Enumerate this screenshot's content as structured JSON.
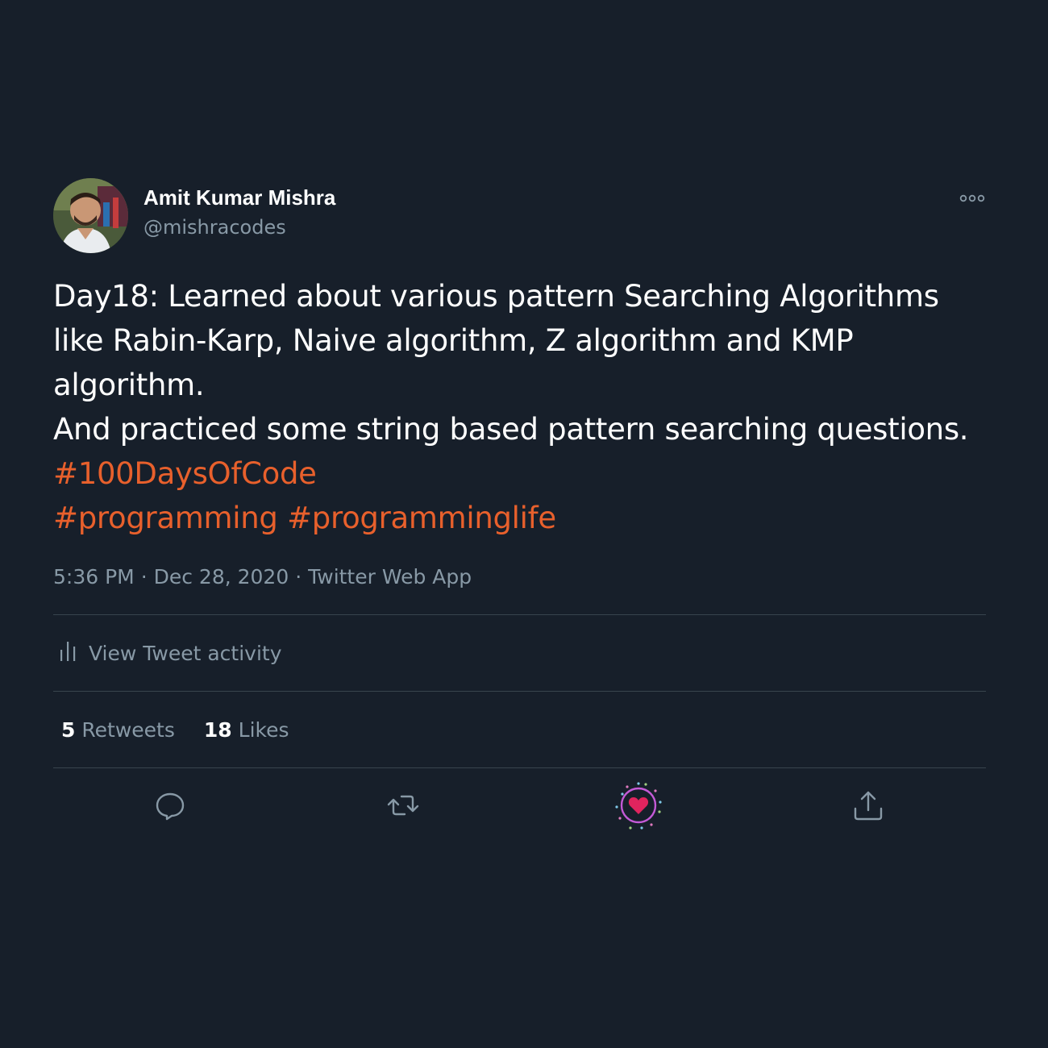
{
  "author": {
    "display_name": "Amit Kumar Mishra",
    "handle": "@mishracodes"
  },
  "tweet": {
    "text": "Day18: Learned about various pattern Searching Algorithms like Rabin-Karp, Naive algorithm, Z algorithm and KMP algorithm.\nAnd practiced some string based pattern searching questions.",
    "hashtags": [
      "#100DaysOfCode",
      "#programming",
      "#programminglife"
    ],
    "time": "5:36 PM",
    "date": "Dec 28, 2020",
    "source": "Twitter Web App",
    "separator": "·"
  },
  "activity": {
    "label": "View Tweet activity"
  },
  "stats": {
    "retweets_count": "5",
    "retweets_label": "Retweets",
    "likes_count": "18",
    "likes_label": "Likes"
  },
  "actions": {
    "reply_icon": "reply-icon",
    "retweet_icon": "retweet-icon",
    "like_icon": "heart-icon",
    "share_icon": "share-icon",
    "like_state": "liked"
  },
  "colors": {
    "background": "#171f2a",
    "hashtag": "#e8602c",
    "secondary_text": "#8899a6",
    "like": "#e0245e",
    "divider": "#38444d"
  }
}
